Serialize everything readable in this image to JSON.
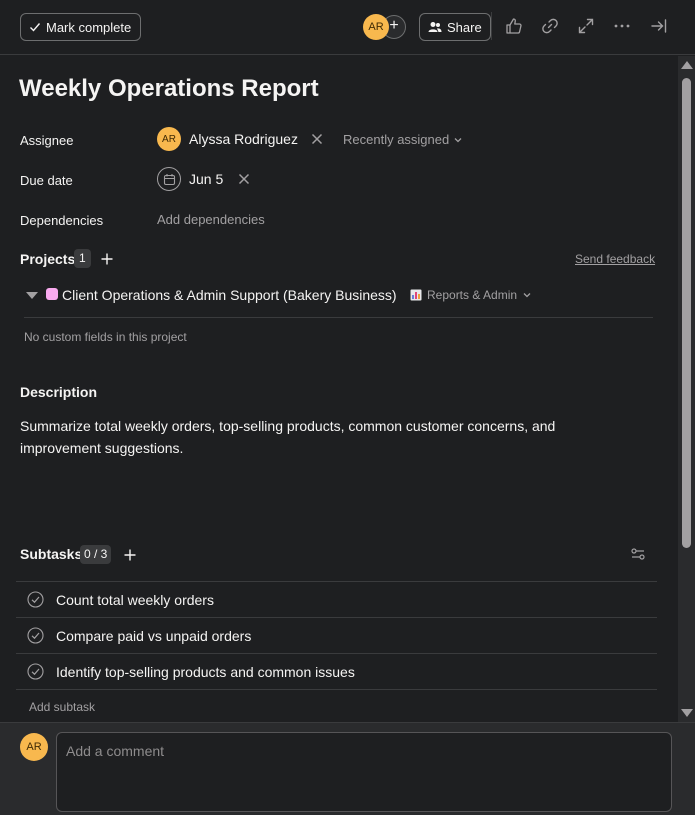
{
  "toolbar": {
    "mark_complete_label": "Mark complete",
    "collaborator_initials": "AR",
    "share_label": "Share",
    "icons": [
      "thumbs-up-icon",
      "link-icon",
      "expand-icon",
      "more-icon",
      "close-panel-icon"
    ]
  },
  "task": {
    "title": "Weekly Operations Report",
    "fields": {
      "assignee_label": "Assignee",
      "assignee_initials": "AR",
      "assignee_name": "Alyssa Rodriguez",
      "recently_assigned_label": "Recently assigned",
      "due_date_label": "Due date",
      "due_date_value": "Jun 5",
      "dependencies_label": "Dependencies",
      "add_dependencies_label": "Add dependencies"
    },
    "projects": {
      "label": "Projects",
      "count": "1",
      "send_feedback_label": "Send feedback",
      "items": [
        {
          "name": "Client Operations & Admin Support (Bakery Business)",
          "color": "#f9aaef",
          "section": "Reports & Admin"
        }
      ],
      "no_custom_fields": "No custom fields in this project"
    },
    "description": {
      "label": "Description",
      "text": "Summarize total weekly orders, top-selling products, common customer concerns, and improvement suggestions."
    },
    "subtasks": {
      "label": "Subtasks",
      "progress": "0 / 3",
      "items": [
        {
          "name": "Count total weekly orders",
          "completed": false
        },
        {
          "name": "Compare paid vs unpaid orders",
          "completed": false
        },
        {
          "name": "Identify top-selling products and common issues",
          "completed": false
        }
      ],
      "add_label": "Add subtask"
    }
  },
  "comment": {
    "avatar_initials": "AR",
    "placeholder": "Add a comment"
  },
  "colors": {
    "background": "#1e1f21",
    "avatar": "#f8b84e",
    "border": "#3a3b3d"
  }
}
